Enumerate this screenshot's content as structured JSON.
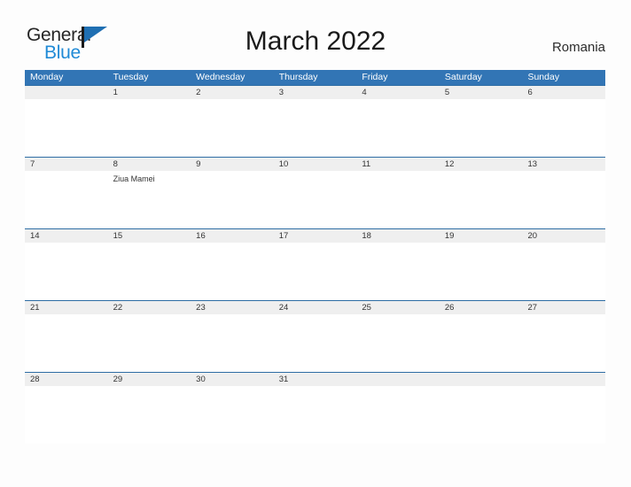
{
  "brand": {
    "word_one": "General",
    "word_two": "Blue",
    "flag_icon": "blue-flag-triangle",
    "accent_color": "#1f8ad6",
    "flag_color": "#1f6fb2"
  },
  "header": {
    "title": "March 2022",
    "country": "Romania"
  },
  "calendar": {
    "header_color": "#3275b5",
    "date_band_color": "#efefef",
    "rule_color": "#2e6da4",
    "weekdays": [
      "Monday",
      "Tuesday",
      "Wednesday",
      "Thursday",
      "Friday",
      "Saturday",
      "Sunday"
    ],
    "weeks": [
      {
        "days": [
          {
            "date": "",
            "event": ""
          },
          {
            "date": "1",
            "event": ""
          },
          {
            "date": "2",
            "event": ""
          },
          {
            "date": "3",
            "event": ""
          },
          {
            "date": "4",
            "event": ""
          },
          {
            "date": "5",
            "event": ""
          },
          {
            "date": "6",
            "event": ""
          }
        ]
      },
      {
        "days": [
          {
            "date": "7",
            "event": ""
          },
          {
            "date": "8",
            "event": "Ziua Mamei"
          },
          {
            "date": "9",
            "event": ""
          },
          {
            "date": "10",
            "event": ""
          },
          {
            "date": "11",
            "event": ""
          },
          {
            "date": "12",
            "event": ""
          },
          {
            "date": "13",
            "event": ""
          }
        ]
      },
      {
        "days": [
          {
            "date": "14",
            "event": ""
          },
          {
            "date": "15",
            "event": ""
          },
          {
            "date": "16",
            "event": ""
          },
          {
            "date": "17",
            "event": ""
          },
          {
            "date": "18",
            "event": ""
          },
          {
            "date": "19",
            "event": ""
          },
          {
            "date": "20",
            "event": ""
          }
        ]
      },
      {
        "days": [
          {
            "date": "21",
            "event": ""
          },
          {
            "date": "22",
            "event": ""
          },
          {
            "date": "23",
            "event": ""
          },
          {
            "date": "24",
            "event": ""
          },
          {
            "date": "25",
            "event": ""
          },
          {
            "date": "26",
            "event": ""
          },
          {
            "date": "27",
            "event": ""
          }
        ]
      },
      {
        "days": [
          {
            "date": "28",
            "event": ""
          },
          {
            "date": "29",
            "event": ""
          },
          {
            "date": "30",
            "event": ""
          },
          {
            "date": "31",
            "event": ""
          },
          {
            "date": "",
            "event": ""
          },
          {
            "date": "",
            "event": ""
          },
          {
            "date": "",
            "event": ""
          }
        ]
      }
    ]
  }
}
